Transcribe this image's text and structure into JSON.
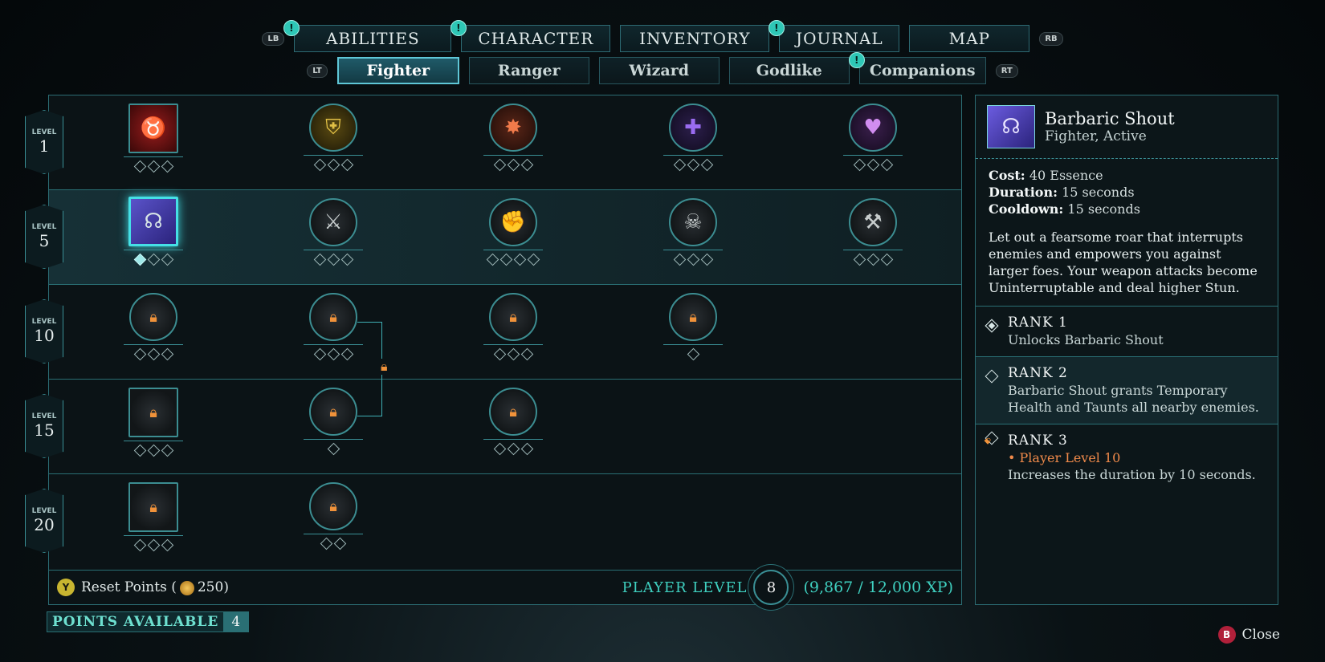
{
  "hints": {
    "lb": "LB",
    "rb": "RB",
    "lt": "LT",
    "rt": "RT"
  },
  "main_tabs": [
    {
      "label": "ABILITIES",
      "alert": "!"
    },
    {
      "label": "CHARACTER",
      "alert": "!"
    },
    {
      "label": "INVENTORY"
    },
    {
      "label": "JOURNAL",
      "alert": "!"
    },
    {
      "label": "MAP"
    }
  ],
  "sub_tabs": [
    {
      "label": "Fighter",
      "active": true
    },
    {
      "label": "Ranger"
    },
    {
      "label": "Wizard"
    },
    {
      "label": "Godlike"
    },
    {
      "label": "Companions",
      "alert": "!"
    }
  ],
  "rows": [
    {
      "level_label": "LEVEL",
      "level": "1"
    },
    {
      "level_label": "LEVEL",
      "level": "5"
    },
    {
      "level_label": "LEVEL",
      "level": "10"
    },
    {
      "level_label": "LEVEL",
      "level": "15"
    },
    {
      "level_label": "LEVEL",
      "level": "20"
    }
  ],
  "footer": {
    "reset_button": "Y",
    "reset_label": "Reset Points",
    "reset_open": "(",
    "reset_value": "250",
    "reset_close": ")",
    "player_level_label": "PLAYER LEVEL",
    "player_level": "8",
    "xp": "(9,867 / 12,000 XP)"
  },
  "detail": {
    "title": "Barbaric Shout",
    "subtitle": "Fighter, Active",
    "cost_label": "Cost:",
    "cost": "40 Essence",
    "duration_label": "Duration:",
    "duration": "15 seconds",
    "cooldown_label": "Cooldown:",
    "cooldown": "15 seconds",
    "description": "Let out a fearsome roar that interrupts enemies and empowers you against larger foes. Your weapon attacks become Uninterruptable and deal higher Stun.",
    "ranks": [
      {
        "title": "RANK 1",
        "text": "Unlocks Barbaric Shout"
      },
      {
        "title": "RANK 2",
        "text": "Barbaric Shout grants Temporary Health and Taunts all nearby enemies."
      },
      {
        "title": "RANK 3",
        "requirement": "• Player Level 10",
        "text": "Increases the duration by 10 seconds."
      }
    ]
  },
  "points": {
    "label": "POINTS AVAILABLE",
    "value": "4"
  },
  "close": {
    "button": "B",
    "label": "Close"
  },
  "colors": {
    "accent": "#3fd0c0",
    "border": "#2b6c73",
    "locked": "#f0923a"
  }
}
